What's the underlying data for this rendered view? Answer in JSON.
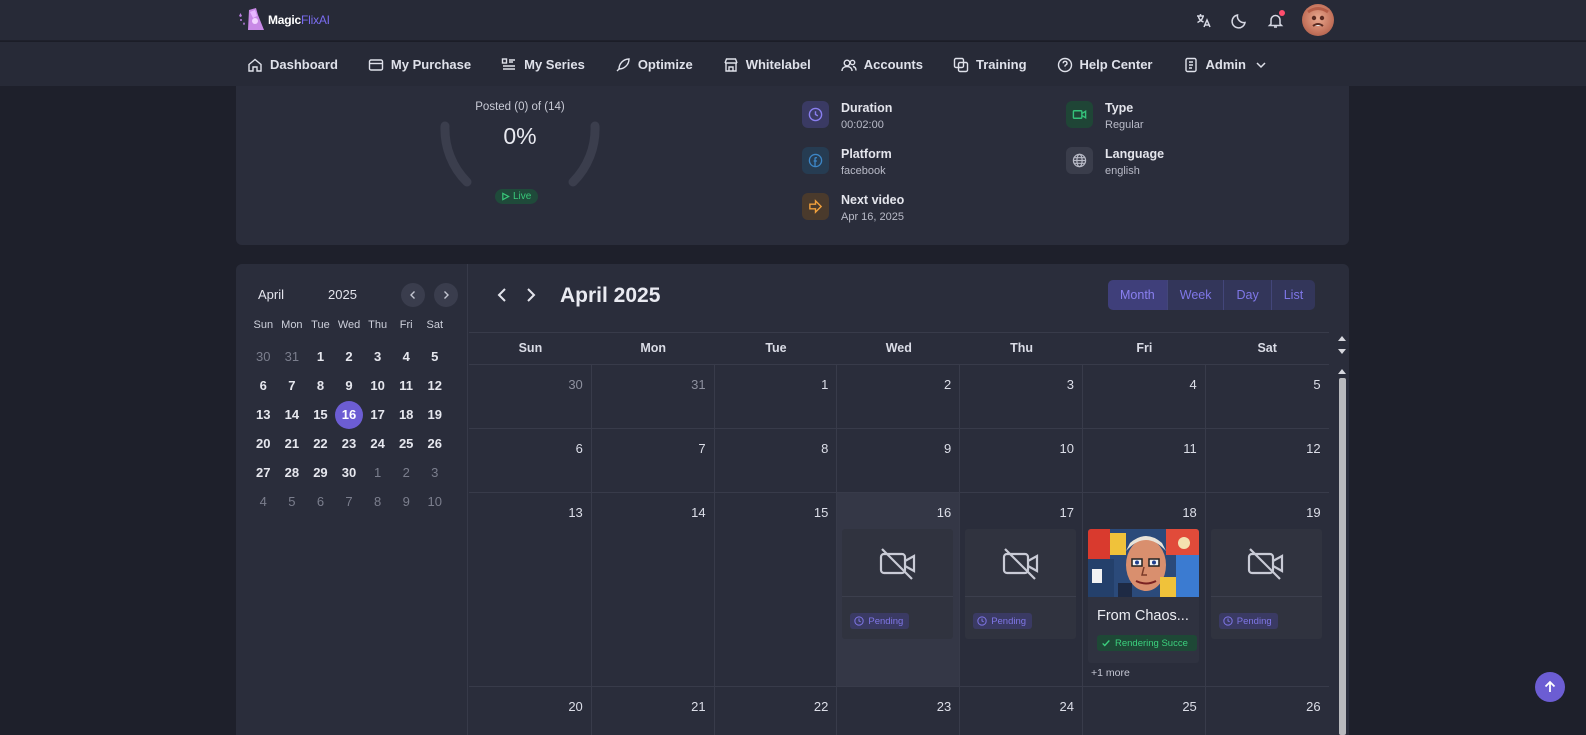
{
  "brand": {
    "name_main": "Magic",
    "name_accent": "FlixAI"
  },
  "header_icons": [
    "translate-icon",
    "moon-icon",
    "bell-icon",
    "user-avatar"
  ],
  "nav": [
    {
      "label": "Dashboard",
      "icon": "home-icon"
    },
    {
      "label": "My Purchase",
      "icon": "card-icon"
    },
    {
      "label": "My Series",
      "icon": "list-icon"
    },
    {
      "label": "Optimize",
      "icon": "rocket-icon"
    },
    {
      "label": "Whitelabel",
      "icon": "store-icon"
    },
    {
      "label": "Accounts",
      "icon": "users-icon"
    },
    {
      "label": "Training",
      "icon": "copy-icon"
    },
    {
      "label": "Help Center",
      "icon": "help-icon"
    },
    {
      "label": "Admin",
      "icon": "document-icon",
      "dropdown": true
    }
  ],
  "progress": {
    "subtitle": "Posted (0) of (14)",
    "value_text": "0%",
    "value": 0,
    "status": "Live"
  },
  "details": {
    "duration": {
      "label": "Duration",
      "value": "00:02:00"
    },
    "type": {
      "label": "Type",
      "value": "Regular"
    },
    "platform": {
      "label": "Platform",
      "value": "facebook"
    },
    "language": {
      "label": "Language",
      "value": "english"
    },
    "next_video": {
      "label": "Next video",
      "value": "Apr 16, 2025"
    }
  },
  "mini_calendar": {
    "month": "April",
    "year": "2025",
    "weekdays": [
      "Sun",
      "Mon",
      "Tue",
      "Wed",
      "Thu",
      "Fri",
      "Sat"
    ],
    "weeks": [
      [
        "30",
        "31",
        "1",
        "2",
        "3",
        "4",
        "5"
      ],
      [
        "6",
        "7",
        "8",
        "9",
        "10",
        "11",
        "12"
      ],
      [
        "13",
        "14",
        "15",
        "16",
        "17",
        "18",
        "19"
      ],
      [
        "20",
        "21",
        "22",
        "23",
        "24",
        "25",
        "26"
      ],
      [
        "27",
        "28",
        "29",
        "30",
        "1",
        "2",
        "3"
      ],
      [
        "4",
        "5",
        "6",
        "7",
        "8",
        "9",
        "10"
      ]
    ],
    "selected": "16"
  },
  "calendar": {
    "title": "April 2025",
    "views": [
      "Month",
      "Week",
      "Day",
      "List"
    ],
    "active_view": "Month",
    "weekdays": [
      "Sun",
      "Mon",
      "Tue",
      "Wed",
      "Thu",
      "Fri",
      "Sat"
    ],
    "weeks": [
      [
        "30",
        "31",
        "1",
        "2",
        "3",
        "4",
        "5"
      ],
      [
        "6",
        "7",
        "8",
        "9",
        "10",
        "11",
        "12"
      ],
      [
        "13",
        "14",
        "15",
        "16",
        "17",
        "18",
        "19"
      ],
      [
        "20",
        "21",
        "22",
        "23",
        "24",
        "25",
        "26"
      ]
    ],
    "events": {
      "wed": {
        "status": "Pending"
      },
      "thu": {
        "status": "Pending"
      },
      "fri": {
        "title": "From Chaos...",
        "status": "Rendering Succe",
        "more": "+1 more"
      },
      "sat": {
        "status": "Pending"
      }
    }
  },
  "colors": {
    "accent": "#6c5dd3",
    "success": "#3cd07e",
    "pending": "#7f76e6"
  }
}
